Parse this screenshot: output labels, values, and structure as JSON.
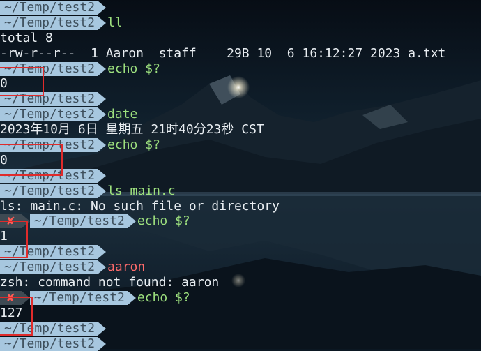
{
  "terminal": {
    "prompt_path": "~/Temp/test2",
    "error_marker": "✘",
    "lines": [
      {
        "type": "prompt",
        "cmd": ""
      },
      {
        "type": "prompt",
        "cmd": "ll"
      },
      {
        "type": "output",
        "text": "total 8"
      },
      {
        "type": "output",
        "text": "-rw-r--r--  1 Aaron  staff    29B 10  6 16:12:27 2023 a.txt"
      },
      {
        "type": "prompt",
        "cmd": "echo $?"
      },
      {
        "type": "output",
        "text": "0"
      },
      {
        "type": "prompt",
        "cmd": ""
      },
      {
        "type": "prompt",
        "cmd": "date"
      },
      {
        "type": "output",
        "text": "2023年10月 6日 星期五 21时40分23秒 CST"
      },
      {
        "type": "prompt",
        "cmd": "echo $?"
      },
      {
        "type": "output",
        "text": "0"
      },
      {
        "type": "prompt",
        "cmd": ""
      },
      {
        "type": "prompt",
        "cmd": "ls main.c"
      },
      {
        "type": "output",
        "text": "ls: main.c: No such file or directory"
      },
      {
        "type": "prompt",
        "error": true,
        "cmd": "echo $?"
      },
      {
        "type": "output",
        "text": "1"
      },
      {
        "type": "prompt",
        "cmd": ""
      },
      {
        "type": "prompt",
        "cmd": "aaron",
        "cmd_color": "red"
      },
      {
        "type": "output",
        "text": "zsh: command not found: aaron"
      },
      {
        "type": "prompt",
        "error": true,
        "cmd": "echo $?"
      },
      {
        "type": "output",
        "text": "127"
      },
      {
        "type": "prompt",
        "cmd": ""
      },
      {
        "type": "prompt",
        "cmd": ""
      }
    ]
  },
  "colors": {
    "prompt_bg": "#a7c7df",
    "prompt_fg": "#3e4f5c",
    "command": "#9de07e",
    "command_not_found": "#ff6b6b",
    "error_marker": "#ff5c55",
    "highlight_box": "#e02b2b"
  }
}
